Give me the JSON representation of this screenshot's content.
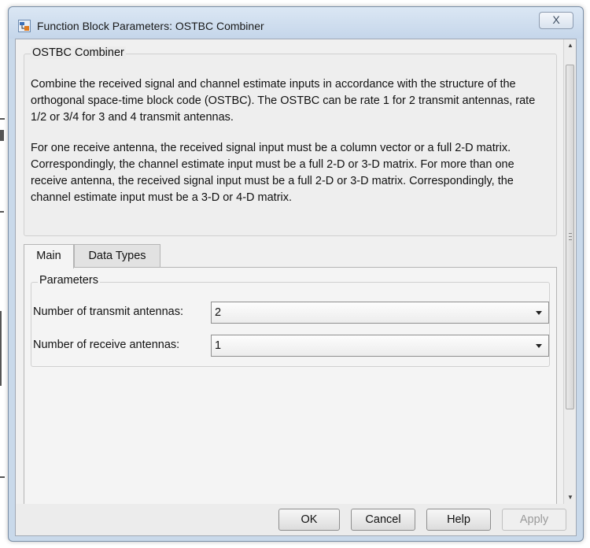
{
  "window": {
    "title": "Function Block Parameters: OSTBC Combiner",
    "close_symbol": "X"
  },
  "description": {
    "group_title": "OSTBC Combiner",
    "paragraph1": "Combine the received signal and channel estimate inputs in accordance with the structure of the orthogonal space-time block code (OSTBC). The OSTBC can be rate 1 for 2 transmit antennas, rate 1/2 or 3/4 for 3 and 4 transmit antennas.",
    "paragraph2": "For one receive antenna, the received signal input must be a column vector or a full 2-D matrix. Correspondingly, the channel estimate input must be a full 2-D or 3-D matrix. For more than one receive antenna, the received signal input must be a full 2-D or 3-D matrix. Correspondingly, the channel estimate input must be a 3-D or 4-D matrix."
  },
  "tabs": [
    {
      "label": "Main",
      "active": true
    },
    {
      "label": "Data Types",
      "active": false
    }
  ],
  "parameters": {
    "group_title": "Parameters",
    "transmit_label": "Number of transmit antennas:",
    "transmit_value": "2",
    "receive_label": "Number of receive antennas:",
    "receive_value": "1"
  },
  "buttons": {
    "ok": "OK",
    "cancel": "Cancel",
    "help": "Help",
    "apply": "Apply"
  },
  "icons": {
    "app": "simulink-block-icon",
    "close": "close-icon",
    "dropdown": "chevron-down-icon"
  }
}
